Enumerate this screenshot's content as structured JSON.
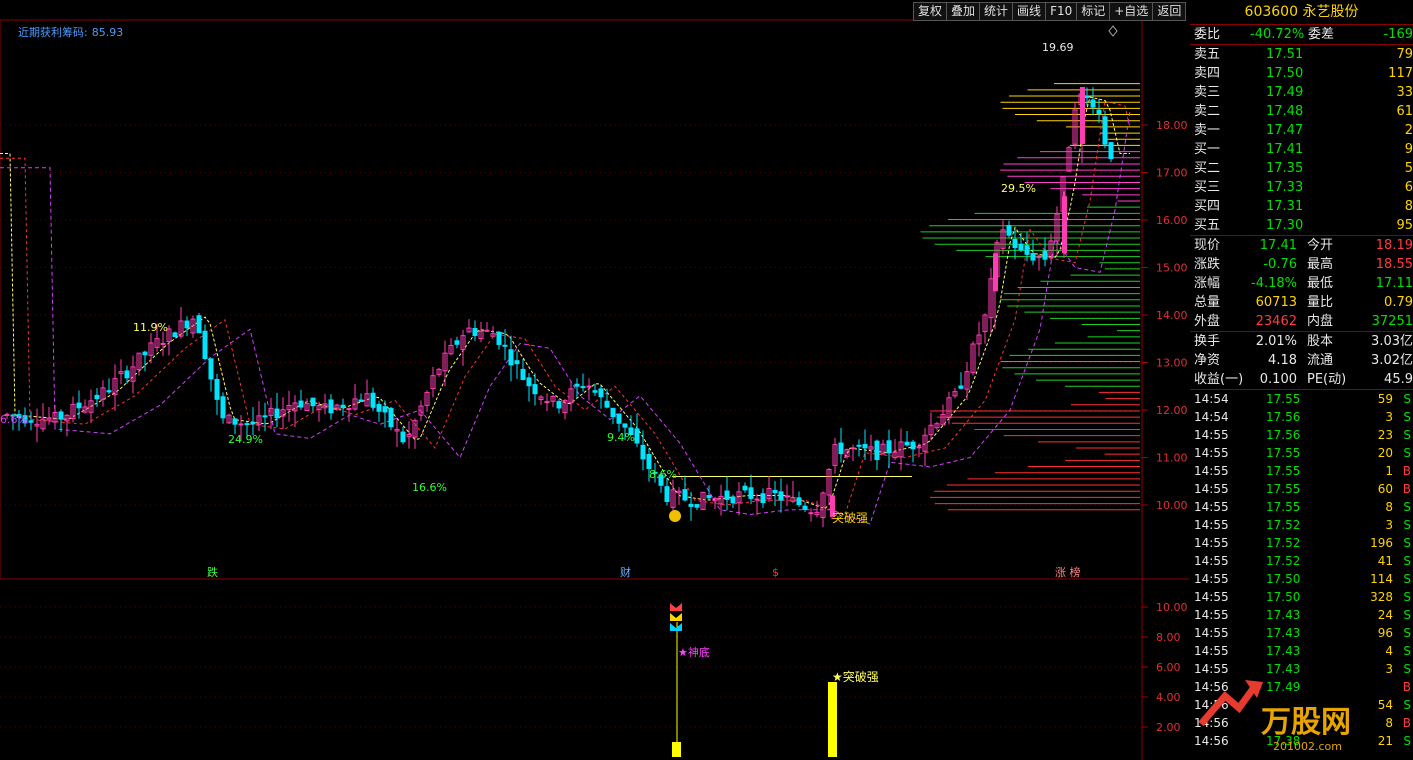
{
  "toolbar": {
    "items": [
      "复权",
      "叠加",
      "统计",
      "画线",
      "F10",
      "标记",
      "+自选",
      "返回"
    ]
  },
  "indicator": {
    "name": "近期获利筹码:",
    "value": "85.93"
  },
  "price_axis": {
    "labels": [
      "18.00",
      "17.00",
      "16.00",
      "15.00",
      "14.00",
      "13.00",
      "12.00",
      "11.00",
      "10.00"
    ],
    "values": [
      18,
      17,
      16,
      15,
      14,
      13,
      12,
      11,
      10
    ]
  },
  "sub_axis": {
    "labels": [
      "10.00",
      "8.00",
      "6.00",
      "4.00",
      "2.00"
    ],
    "values": [
      10,
      8,
      6,
      4,
      2
    ]
  },
  "annotations": {
    "top_price": "19.69",
    "pct_labels": [
      "11.9%",
      "24.9%",
      "16.6%",
      "9.4%",
      "8.6%",
      "29.5%",
      "6.6%"
    ],
    "break_label": "突破强",
    "bottom_markers": [
      "跌",
      "财",
      "$",
      "涨 榜"
    ],
    "shendi": "★神底",
    "break_label_sub": "★突破强"
  },
  "sub_bars": [
    {
      "label": "signal-1",
      "value": 1
    },
    {
      "label": "signal-2",
      "value": 5
    }
  ],
  "stock": {
    "code": "603600",
    "name": "永艺股份"
  },
  "weibi": {
    "label1": "委比",
    "value1": "-40.72%",
    "label2": "委差",
    "value2": "-169"
  },
  "order_book": [
    {
      "label": "卖五",
      "price": "17.51",
      "vol": "79"
    },
    {
      "label": "卖四",
      "price": "17.50",
      "vol": "117"
    },
    {
      "label": "卖三",
      "price": "17.49",
      "vol": "33"
    },
    {
      "label": "卖二",
      "price": "17.48",
      "vol": "61"
    },
    {
      "label": "卖一",
      "price": "17.47",
      "vol": "2"
    },
    {
      "label": "买一",
      "price": "17.41",
      "vol": "9"
    },
    {
      "label": "买二",
      "price": "17.35",
      "vol": "5"
    },
    {
      "label": "买三",
      "price": "17.33",
      "vol": "6"
    },
    {
      "label": "买四",
      "price": "17.31",
      "vol": "8"
    },
    {
      "label": "买五",
      "price": "17.30",
      "vol": "95"
    }
  ],
  "quote": [
    {
      "l1": "现价",
      "v1": "17.41",
      "l2": "今开",
      "v2": "18.19"
    },
    {
      "l1": "涨跌",
      "v1": "-0.76",
      "l2": "最高",
      "v2": "18.55"
    },
    {
      "l1": "涨幅",
      "v1": "-4.18%",
      "l2": "最低",
      "v2": "17.11"
    },
    {
      "l1": "总量",
      "v1": "60713",
      "l2": "量比",
      "v2": "0.79"
    },
    {
      "l1": "外盘",
      "v1": "23462",
      "l2": "内盘",
      "v2": "37251"
    }
  ],
  "fundamentals": [
    {
      "l1": "换手",
      "v1": "2.01%",
      "l2": "股本",
      "v2": "3.03亿"
    },
    {
      "l1": "净资",
      "v1": "4.18",
      "l2": "流通",
      "v2": "3.02亿"
    },
    {
      "l1": "收益(一)",
      "v1": "0.100",
      "l2": "PE(动)",
      "v2": "45.9"
    }
  ],
  "trades": [
    {
      "t": "14:54",
      "p": "17.55",
      "v": "59",
      "s": "S"
    },
    {
      "t": "14:54",
      "p": "17.56",
      "v": "3",
      "s": "S"
    },
    {
      "t": "14:55",
      "p": "17.56",
      "v": "23",
      "s": "S"
    },
    {
      "t": "14:55",
      "p": "17.55",
      "v": "20",
      "s": "S"
    },
    {
      "t": "14:55",
      "p": "17.55",
      "v": "1",
      "s": "B"
    },
    {
      "t": "14:55",
      "p": "17.55",
      "v": "60",
      "s": "B"
    },
    {
      "t": "14:55",
      "p": "17.55",
      "v": "8",
      "s": "S"
    },
    {
      "t": "14:55",
      "p": "17.52",
      "v": "3",
      "s": "S"
    },
    {
      "t": "14:55",
      "p": "17.52",
      "v": "196",
      "s": "S"
    },
    {
      "t": "14:55",
      "p": "17.52",
      "v": "41",
      "s": "S"
    },
    {
      "t": "14:55",
      "p": "17.50",
      "v": "114",
      "s": "S"
    },
    {
      "t": "14:55",
      "p": "17.50",
      "v": "328",
      "s": "S"
    },
    {
      "t": "14:55",
      "p": "17.43",
      "v": "24",
      "s": "S"
    },
    {
      "t": "14:55",
      "p": "17.43",
      "v": "96",
      "s": "S"
    },
    {
      "t": "14:55",
      "p": "17.43",
      "v": "4",
      "s": "S"
    },
    {
      "t": "14:55",
      "p": "17.43",
      "v": "3",
      "s": "S"
    },
    {
      "t": "14:56",
      "p": "17.49",
      "v": "",
      "s": "B"
    },
    {
      "t": "14:56",
      "p": "",
      "v": "54",
      "s": "S"
    },
    {
      "t": "14:56",
      "p": "",
      "v": "8",
      "s": "B"
    },
    {
      "t": "14:56",
      "p": "17.38",
      "v": "21",
      "s": "S"
    }
  ],
  "watermark": {
    "text": "万股网",
    "url": "201002.com"
  },
  "colors": {
    "up": "#ff3b3b",
    "down": "#00e000",
    "bull_candle": "#ff3cb4",
    "bear_candle": "#00e5ff",
    "label": "#ffd400"
  }
}
